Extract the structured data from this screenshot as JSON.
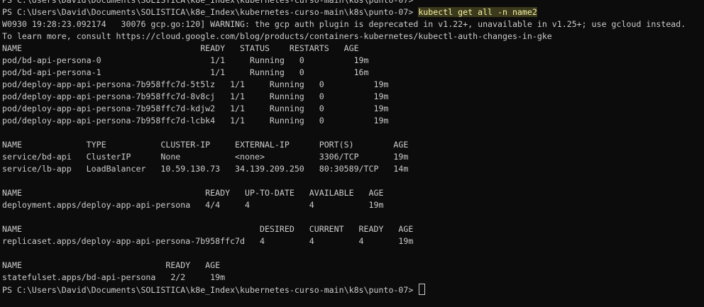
{
  "terminal": {
    "prompt": "PS C:\\Users\\David\\Documents\\SOLISTICA\\k8e_Index\\kubernetes-curso-main\\k8s\\punto-07> ",
    "command": "kubectl get all -n name2",
    "warning_line_1": "W0930 19:28:23.092174   30076 gcp.go:120] WARNING: the gcp auth plugin is deprecated in v1.22+, unavailable in v1.25+; use gcloud instead.",
    "warning_line_2": "To learn more, consult https://cloud.google.com/blog/products/containers-kubernetes/kubectl-auth-changes-in-gke",
    "pods_header": "NAME                                    READY   STATUS    RESTARTS   AGE",
    "pods": [
      "pod/bd-api-persona-0                      1/1     Running   0          19m",
      "pod/bd-api-persona-1                      1/1     Running   0          16m",
      "pod/deploy-app-api-persona-7b958ffc7d-5t5lz   1/1     Running   0          19m",
      "pod/deploy-app-api-persona-7b958ffc7d-8v8cj   1/1     Running   0          19m",
      "pod/deploy-app-api-persona-7b958ffc7d-kdjw2   1/1     Running   0          19m",
      "pod/deploy-app-api-persona-7b958ffc7d-lcbk4   1/1     Running   0          19m"
    ],
    "services_header": "NAME             TYPE           CLUSTER-IP     EXTERNAL-IP      PORT(S)        AGE",
    "services": [
      "service/bd-api   ClusterIP      None           <none>           3306/TCP       19m",
      "service/lb-app   LoadBalancer   10.59.130.73   34.139.209.250   80:30589/TCP   14m"
    ],
    "deployments_header": "NAME                                     READY   UP-TO-DATE   AVAILABLE   AGE",
    "deployments": [
      "deployment.apps/deploy-app-api-persona   4/4     4            4           19m"
    ],
    "replicasets_header": "NAME                                                DESIRED   CURRENT   READY   AGE",
    "replicasets": [
      "replicaset.apps/deploy-app-api-persona-7b958ffc7d   4         4         4       19m"
    ],
    "statefulsets_header": "NAME                             READY   AGE",
    "statefulsets": [
      "statefulset.apps/bd-api-persona   2/2     19m"
    ],
    "final_prompt": "PS C:\\Users\\David\\Documents\\SOLISTICA\\k8e_Index\\kubernetes-curso-main\\k8s\\punto-07> "
  },
  "colors": {
    "background": "#0c0c0c",
    "foreground": "#cccccc",
    "command_highlight_text": "#f9f1a5",
    "command_highlight_bg": "#3b3a1c"
  }
}
